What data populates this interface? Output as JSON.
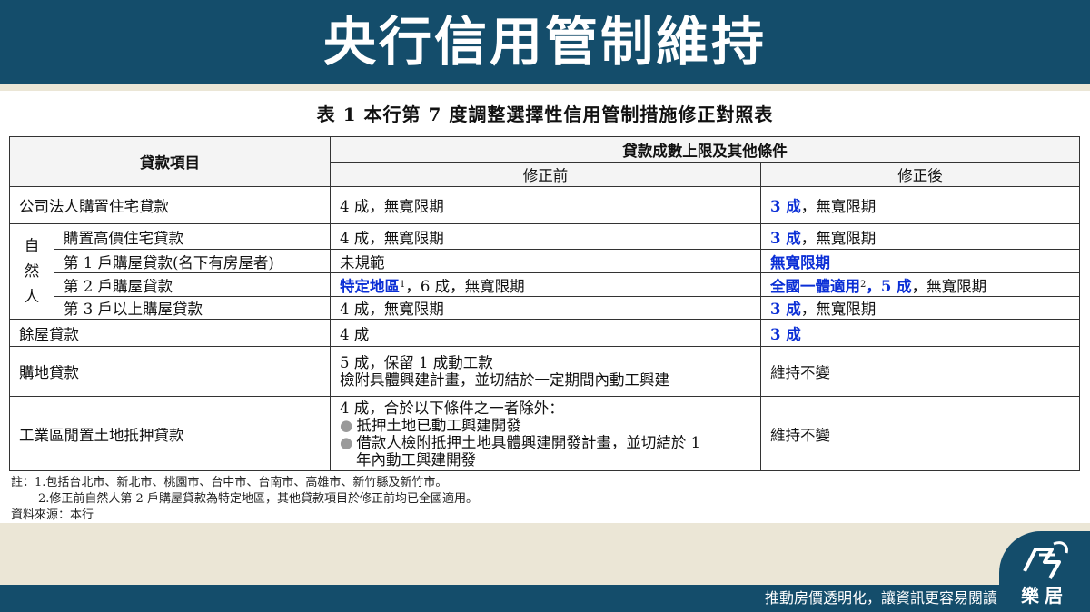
{
  "header": {
    "title": "央行信用管制維持"
  },
  "table": {
    "title": "表 1 本行第 7 度調整選擇性信用管制措施修正對照表",
    "col_item": "貸款項目",
    "col_group": "貸款成數上限及其他條件",
    "col_before": "修正前",
    "col_after": "修正後",
    "natural_person_label": [
      "自",
      "然",
      "人"
    ],
    "rows": {
      "corp": {
        "item": "公司法人購置住宅貸款",
        "before": "4 成，無寬限期",
        "after_hl": "3 成",
        "after_rest": "，無寬限期"
      },
      "high": {
        "item": "購置高價住宅貸款",
        "before": "4 成，無寬限期",
        "after_hl": "3 成",
        "after_rest": "，無寬限期"
      },
      "first": {
        "item": "第 1 戶購屋貸款(名下有房屋者)",
        "before": "未規範",
        "after_hl": "無寬限期"
      },
      "second": {
        "item": "第 2 戶購屋貸款",
        "before_hl": "特定地區",
        "before_sup": "1",
        "before_rest": "，6 成，無寬限期",
        "after_hl": "全國一體適用",
        "after_sup": "2",
        "after_hl2": "，5 成",
        "after_rest": "，無寬限期"
      },
      "third": {
        "item": "第 3 戶以上購屋貸款",
        "before": "4 成，無寬限期",
        "after_hl": "3 成",
        "after_rest": "，無寬限期"
      },
      "surplus": {
        "item": "餘屋貸款",
        "before": "4 成",
        "after_hl": "3 成"
      },
      "land": {
        "item": "購地貸款",
        "before_l1": "5 成，保留 1 成動工款",
        "before_l2": "檢附具體興建計畫，並切結於一定期間內動工興建",
        "after": "維持不變"
      },
      "industrial": {
        "item": "工業區閒置土地抵押貸款",
        "before_l1": "4 成，合於以下條件之一者除外：",
        "before_b1": "抵押土地已動工興建開發",
        "before_b2": "借款人檢附抵押土地具體興建開發計畫，並切結於 1",
        "before_b2_cont": "年內動工興建開發",
        "after": "維持不變"
      }
    }
  },
  "notes": [
    "註：1.包括台北市、新北市、桃園市、台中市、台南市、高雄市、新竹縣及新竹市。",
    "2.修正前自然人第 2 戶購屋貸款為特定地區，其他貸款項目於修正前均已全國適用。",
    "資料來源：本行"
  ],
  "footer": {
    "slogan": "推動房價透明化，讓資訊更容易閱讀",
    "logo_text": "樂居"
  },
  "colors": {
    "brand": "#144d6b",
    "highlight": "#0b2fd6",
    "background": "#ebe6d6"
  }
}
